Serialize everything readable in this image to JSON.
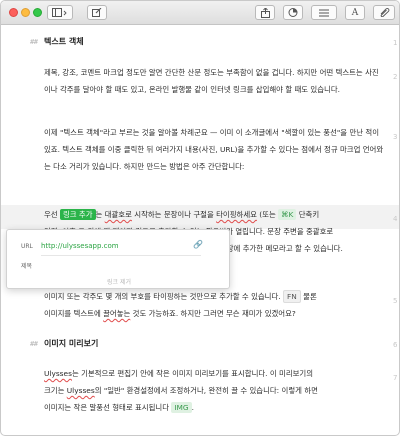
{
  "toolbar": {
    "icons": [
      "sidebar-toggle-icon",
      "compose-icon",
      "share-icon",
      "stats-icon",
      "list-icon",
      "typography-icon",
      "attachment-icon"
    ],
    "typography_label": "A"
  },
  "editor": {
    "heading1": {
      "marker": "##",
      "text": "텍스트 객체"
    },
    "para1": "제목, 강조, 코멘트 마크업 정도만 알면 간단한 산문 정도는 부족함이 없을 겁니다. 하지만 어떤 텍스트는 사진이나 각주를 달아야 할 때도 있고, 온라인 발행물 같이 인터넷 링크를 삽입해야 할 때도 있습니다.",
    "para2": "이제 \"텍스트 객체\"라고 부르는 것을 알아볼 차례군요 — 이미 이 소개글에서 \"색깔이 있는 풍선\"을 만난 적이 있죠. 텍스트 객체를 이중 클릭한 뒤 여러가지 내용(사진, URL)을 추가할 수 있다는 점에서 정규 마크업 언어와는 다소 거리가 있습니다. 하지만 만드는 방법은 아주 간단합니다:",
    "para3": {
      "t1": "우선",
      "link": "링크 추가",
      "t2": "는",
      "t3": "대괄호로",
      "t4": "시작하는 문장이나 구절을",
      "t5": "타이핑하세요",
      "t6": "(또는",
      "kbd": "⌘K",
      "t7": "단축키",
      "line2": "입력. 이후 그 외에 웹 페이지 링크를 추가할 수 있는 팝오버가 열립니다. 문장 주변을 중괄호로",
      "line3": "으로 문장에 추가한 메모라고 할 수 있습니다."
    },
    "para4": {
      "t1": "이미지 또는 각주도 몇 개의 부호를 타이핑하는 것만으로 추가할 수 있습니다.",
      "fn": "FN",
      "t2": "물론",
      "t3": "이미지를 텍스트에",
      "t4": "끌어놓는",
      "t5": "것도 가능하죠. 하지만 그러면 무슨 재미가 있겠어요?"
    },
    "heading2": {
      "marker": "##",
      "text": "이미지 미리보기"
    },
    "para5": {
      "w1": "Ulysses",
      "t1": "는 기본적으로 편집기 안에 작은 이미지 미리보기를 표시합니다. 이 미리보기의",
      "t2": "크기는",
      "w2": "Ulysses",
      "t3": "의 \"일반\" 환경설정에서 조정하거나, 완전히 끌 수 있습니다: 이렇게 하면",
      "t4": "이미지는 작은 말풍선 형태로 표시됩니다",
      "img": "IMG",
      "t5": "."
    }
  },
  "popover": {
    "url_label": "URL",
    "url_value": "http://ulyssesapp.com",
    "title_label": "제목",
    "remove_label": "링크 제거"
  },
  "gutter": [
    "1",
    "2",
    "3",
    "4",
    "5",
    "6",
    "7",
    "8",
    "9"
  ]
}
